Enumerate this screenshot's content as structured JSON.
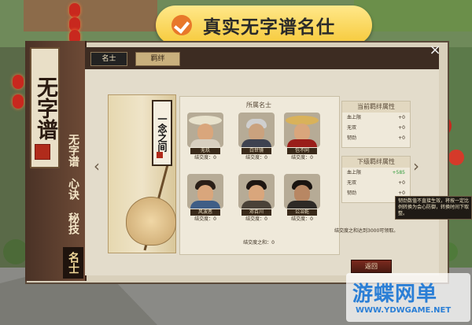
{
  "banner": {
    "text": "真实无字谱名仕"
  },
  "sidebar": {
    "title": "无字谱",
    "tabs": [
      {
        "label": "无字谱",
        "active": false
      },
      {
        "label": "心诀",
        "active": false
      },
      {
        "label": "秘技",
        "active": false
      },
      {
        "label": "名士",
        "active": true
      }
    ]
  },
  "header": {
    "tabs": [
      {
        "label": "名士",
        "active": true
      },
      {
        "label": "羁绊",
        "active": false
      }
    ],
    "close": "×"
  },
  "scroll": {
    "label": "一念之间"
  },
  "roster": {
    "title": "所属名士",
    "heroes": [
      {
        "name": "无玖",
        "favor": "结交度：0"
      },
      {
        "name": "白世镜",
        "favor": "结交度：0"
      },
      {
        "name": "包不同",
        "favor": "结交度：0"
      },
      {
        "name": "风波恶",
        "favor": "结交度：0"
      },
      {
        "name": "邓百川",
        "favor": "结交度：0"
      },
      {
        "name": "公冶乾",
        "favor": "结交度：0"
      }
    ],
    "total": "结交度之和：0"
  },
  "current_attrs": {
    "title": "当前羁绊属性",
    "rows": [
      {
        "label": "血上限",
        "value": "+0"
      },
      {
        "label": "无双",
        "value": "+0"
      },
      {
        "label": "韧劲",
        "value": "+0"
      }
    ]
  },
  "next_attrs": {
    "title": "下级羁绊属性",
    "rows": [
      {
        "label": "血上限",
        "value": "+585",
        "green": true
      },
      {
        "label": "无双",
        "value": "+0"
      },
      {
        "label": "韧劲",
        "value": "+0"
      }
    ]
  },
  "tooltip": "韧劲数值不直接生效，将按一定比例转换为会心防御，转换时间下取整。",
  "hint": "结交度之和达到3000可领取。",
  "return_button": "返回",
  "watermark": {
    "title": "游蝶网单",
    "url": "WWW.YDWGAME.NET"
  }
}
